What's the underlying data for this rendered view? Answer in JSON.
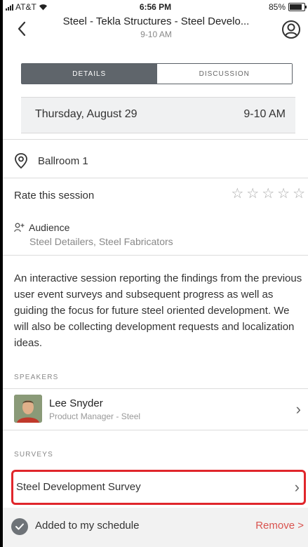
{
  "status_bar": {
    "carrier": "AT&T",
    "time": "6:56 PM",
    "battery": "85%",
    "battery_level": 0.85
  },
  "nav": {
    "title": "Steel - Tekla Structures - Steel Develo...",
    "subtitle": "9-10 AM",
    "back_icon": "chevron-left-icon",
    "profile_icon": "user-circle-icon"
  },
  "tabs": [
    {
      "label": "DETAILS",
      "active": true
    },
    {
      "label": "DISCUSSION",
      "active": false
    }
  ],
  "session": {
    "date": "Thursday, August 29",
    "time": "9-10 AM",
    "location": "Ballroom 1",
    "rate_label": "Rate this session",
    "rating": 0,
    "rating_max": 5,
    "audience_label": "Audience",
    "audience": "Steel Detailers, Steel Fabricators",
    "description": "An interactive session reporting the findings from the previous user event surveys and subsequent progress as well as guiding the focus for future steel oriented development. We will also be collecting development requests and localization ideas."
  },
  "speakers": {
    "label": "SPEAKERS",
    "items": [
      {
        "name": "Lee Snyder",
        "role": "Product Manager - Steel"
      }
    ]
  },
  "surveys": {
    "label": "SURVEYS",
    "items": [
      {
        "name": "Steel Development Survey"
      }
    ]
  },
  "schedule": {
    "added_label": "Added to my schedule",
    "remove_label": "Remove >"
  },
  "colors": {
    "active_tab": "#5f656b",
    "highlight_border": "#e0262b",
    "remove": "#d9534f"
  }
}
